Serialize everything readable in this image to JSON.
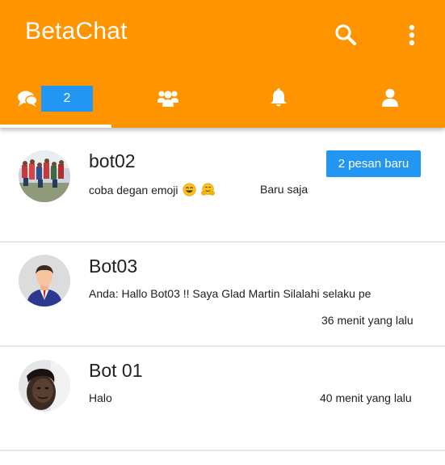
{
  "app": {
    "title": "BetaChat"
  },
  "toolbar": {
    "search_icon": "search-icon",
    "more_icon": "more-vert-icon"
  },
  "tabs": [
    {
      "name": "chats",
      "icon": "chat-bubbles-icon",
      "badge": "2",
      "active": true
    },
    {
      "name": "groups",
      "icon": "group-icon"
    },
    {
      "name": "notifications",
      "icon": "bell-icon"
    },
    {
      "name": "profile",
      "icon": "person-icon"
    }
  ],
  "colors": {
    "primary": "#fe9400",
    "accent": "#2196f3",
    "text": "#212121",
    "divider": "#e6e6e6"
  },
  "chats": [
    {
      "name": "bot02",
      "message": "coba degan emoji",
      "emoji": [
        "grinning-face-emoji",
        "hugging-face-emoji"
      ],
      "time": "Baru saja",
      "badge": "2 pesan baru",
      "avatar": "group-photo-avatar"
    },
    {
      "name": "Bot03",
      "message": "Anda: Hallo Bot03 !! Saya Glad Martin Silalahi selaku pe",
      "time": "36 menit yang lalu",
      "avatar": "default-person-avatar"
    },
    {
      "name": "Bot 01",
      "message": "Halo",
      "time": "40 menit yang lalu",
      "avatar": "person-photo-avatar"
    }
  ]
}
